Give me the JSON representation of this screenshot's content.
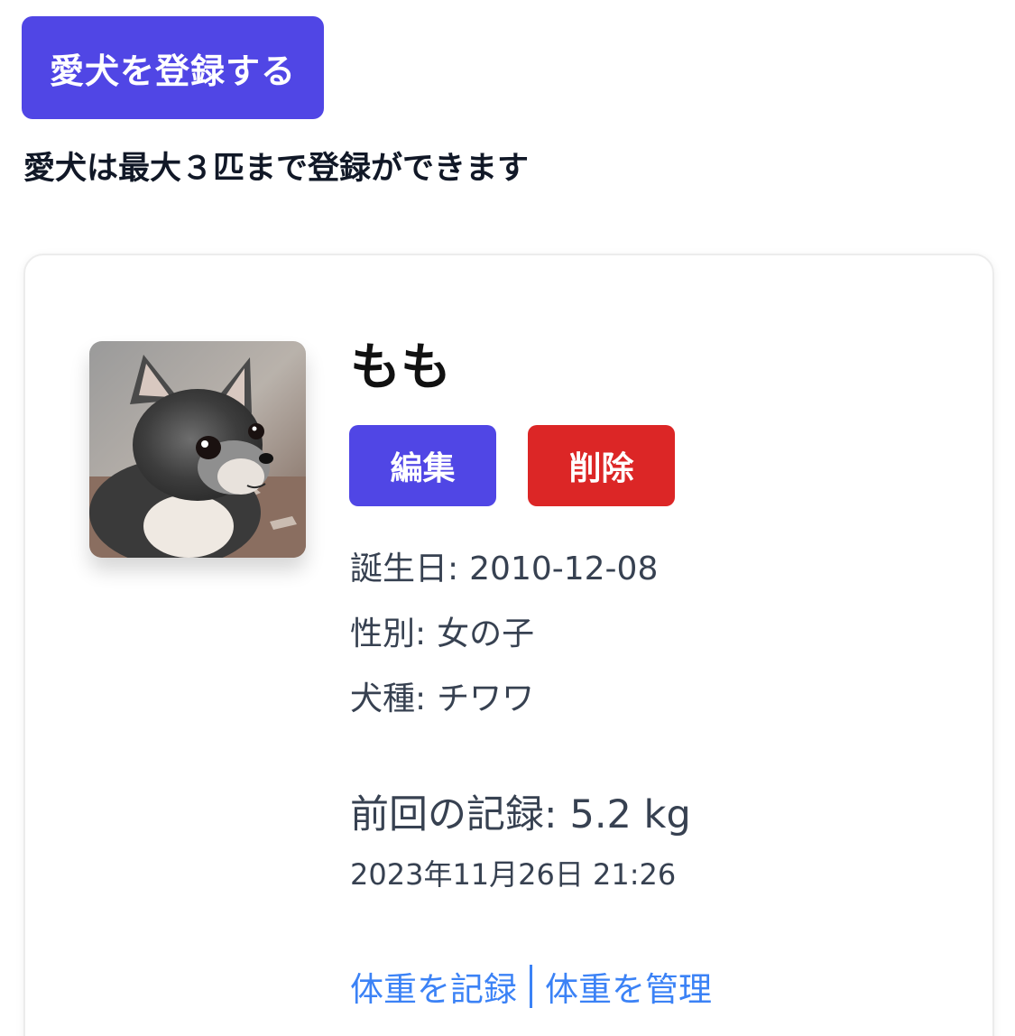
{
  "register_button": {
    "label": "愛犬を登録する"
  },
  "notice": "愛犬は最大３匹まで登録ができます",
  "dog": {
    "name": "もも",
    "edit_label": "編集",
    "delete_label": "削除",
    "birthday_label": "誕生日:",
    "birthday": "2010-12-08",
    "gender_label": "性別:",
    "gender": "女の子",
    "breed_label": "犬種:",
    "breed": "チワワ",
    "last_record_label": "前回の記録:",
    "last_record_value": "5.2 kg",
    "last_record_time": "2023年11月26日 21:26",
    "record_weight_link": "体重を記録",
    "manage_weight_link": "体重を管理"
  },
  "colors": {
    "primary": "#5046e5",
    "danger": "#dc2626",
    "link": "#3b82f6",
    "text": "#374151"
  }
}
